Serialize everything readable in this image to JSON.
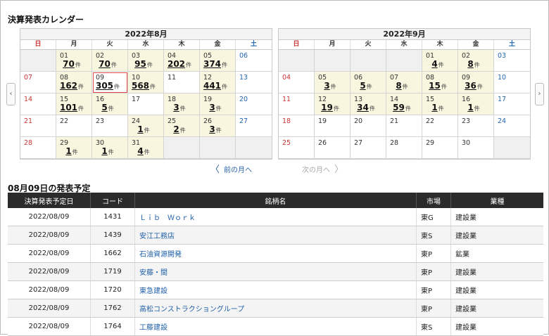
{
  "page_title": "決算発表カレンダー",
  "weekdays": [
    "日",
    "月",
    "火",
    "水",
    "木",
    "金",
    "土"
  ],
  "calendars": [
    {
      "title": "2022年8月",
      "lead_blank": 1,
      "days": [
        {
          "d": "01",
          "n": "70"
        },
        {
          "d": "02",
          "n": "70"
        },
        {
          "d": "03",
          "n": "95"
        },
        {
          "d": "04",
          "n": "202"
        },
        {
          "d": "05",
          "n": "374"
        },
        {
          "d": "06",
          "n": ""
        },
        {
          "d": "07",
          "n": ""
        },
        {
          "d": "08",
          "n": "162"
        },
        {
          "d": "09",
          "n": "305",
          "selected": true
        },
        {
          "d": "10",
          "n": "568"
        },
        {
          "d": "11",
          "n": ""
        },
        {
          "d": "12",
          "n": "441"
        },
        {
          "d": "13",
          "n": ""
        },
        {
          "d": "14",
          "n": ""
        },
        {
          "d": "15",
          "n": "101"
        },
        {
          "d": "16",
          "n": "5"
        },
        {
          "d": "17",
          "n": ""
        },
        {
          "d": "18",
          "n": "3"
        },
        {
          "d": "19",
          "n": "3"
        },
        {
          "d": "20",
          "n": ""
        },
        {
          "d": "21",
          "n": ""
        },
        {
          "d": "22",
          "n": ""
        },
        {
          "d": "23",
          "n": ""
        },
        {
          "d": "24",
          "n": "1"
        },
        {
          "d": "25",
          "n": "2"
        },
        {
          "d": "26",
          "n": "3"
        },
        {
          "d": "27",
          "n": ""
        },
        {
          "d": "28",
          "n": ""
        },
        {
          "d": "29",
          "n": "1"
        },
        {
          "d": "30",
          "n": "1"
        },
        {
          "d": "31",
          "n": "4"
        }
      ],
      "trail_blank": 3
    },
    {
      "title": "2022年9月",
      "lead_blank": 4,
      "days": [
        {
          "d": "01",
          "n": "4"
        },
        {
          "d": "02",
          "n": "8"
        },
        {
          "d": "03",
          "n": ""
        },
        {
          "d": "04",
          "n": ""
        },
        {
          "d": "05",
          "n": "3"
        },
        {
          "d": "06",
          "n": "5"
        },
        {
          "d": "07",
          "n": "8"
        },
        {
          "d": "08",
          "n": "15"
        },
        {
          "d": "09",
          "n": "36"
        },
        {
          "d": "10",
          "n": ""
        },
        {
          "d": "11",
          "n": ""
        },
        {
          "d": "12",
          "n": "19"
        },
        {
          "d": "13",
          "n": "34"
        },
        {
          "d": "14",
          "n": "59"
        },
        {
          "d": "15",
          "n": "1"
        },
        {
          "d": "16",
          "n": "1"
        },
        {
          "d": "17",
          "n": ""
        },
        {
          "d": "18",
          "n": ""
        },
        {
          "d": "19",
          "n": ""
        },
        {
          "d": "20",
          "n": ""
        },
        {
          "d": "21",
          "n": ""
        },
        {
          "d": "22",
          "n": ""
        },
        {
          "d": "23",
          "n": ""
        },
        {
          "d": "24",
          "n": ""
        },
        {
          "d": "25",
          "n": ""
        },
        {
          "d": "26",
          "n": ""
        },
        {
          "d": "27",
          "n": ""
        },
        {
          "d": "28",
          "n": ""
        },
        {
          "d": "29",
          "n": ""
        },
        {
          "d": "30",
          "n": ""
        }
      ],
      "trail_blank": 1
    }
  ],
  "count_unit": "件",
  "nav": {
    "prev": "前の月へ",
    "next": "次の月へ",
    "left_arrow": "‹",
    "right_arrow": "›"
  },
  "schedule": {
    "title": "08月09日の発表予定",
    "columns": [
      "決算発表予定日",
      "コード",
      "銘柄名",
      "市場",
      "業種"
    ],
    "rows": [
      [
        "2022/08/09",
        "1431",
        "Ｌｉｂ　Ｗｏｒｋ",
        "東G",
        "建設業"
      ],
      [
        "2022/08/09",
        "1439",
        "安江工務店",
        "東S",
        "建設業"
      ],
      [
        "2022/08/09",
        "1662",
        "石油資源開発",
        "東P",
        "鉱業"
      ],
      [
        "2022/08/09",
        "1719",
        "安藤・間",
        "東P",
        "建設業"
      ],
      [
        "2022/08/09",
        "1720",
        "東急建設",
        "東P",
        "建設業"
      ],
      [
        "2022/08/09",
        "1762",
        "高松コンストラクショングループ",
        "東P",
        "建設業"
      ],
      [
        "2022/08/09",
        "1764",
        "工藤建設",
        "東S",
        "建設業"
      ]
    ]
  },
  "colors": {
    "sunday": "#cc3333",
    "saturday": "#2366b0",
    "highlight": "#f8f6df",
    "selected_border": "#e34a4a",
    "header_bg": "#2b2b2b",
    "link": "#1f5fa8"
  }
}
